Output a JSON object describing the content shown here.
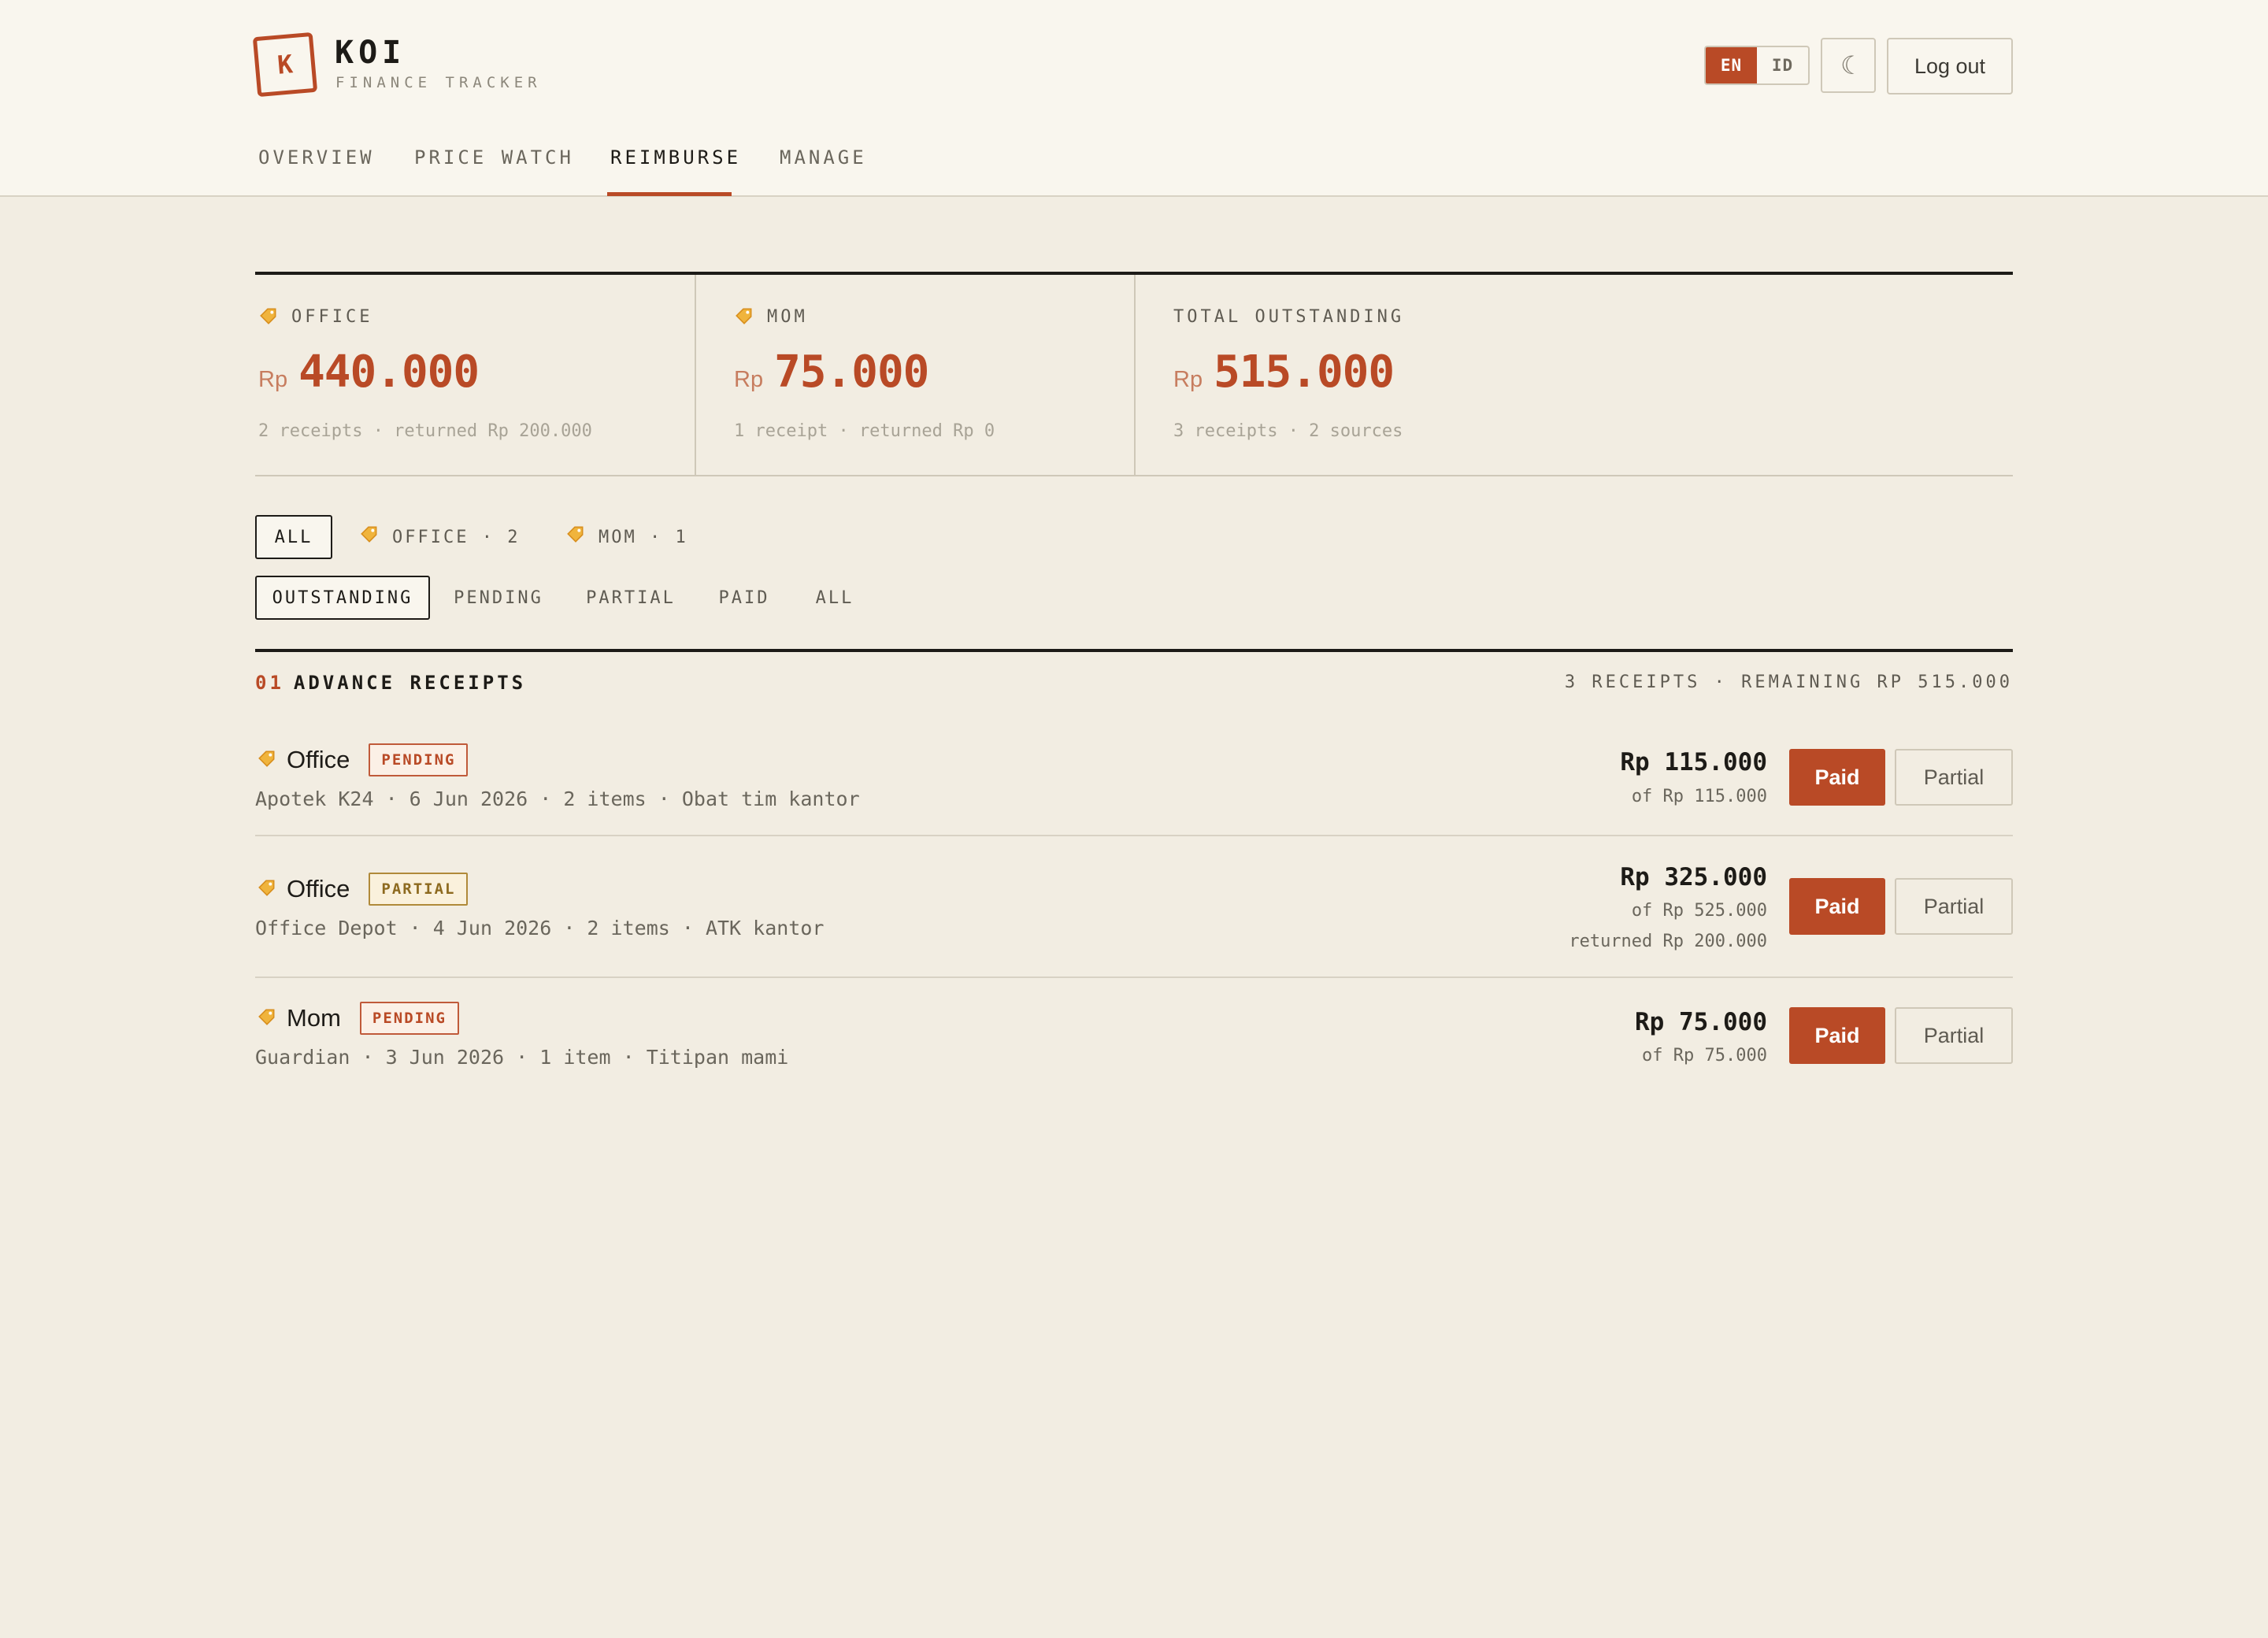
{
  "app": {
    "logo_letter": "K",
    "name": "KOI",
    "subtitle": "FINANCE TRACKER"
  },
  "header": {
    "lang_en": "EN",
    "lang_id": "ID",
    "theme_icon": "☾",
    "logout_label": "Log out"
  },
  "nav": {
    "tabs": [
      "OVERVIEW",
      "PRICE WATCH",
      "REIMBURSE",
      "MANAGE"
    ],
    "active": "REIMBURSE"
  },
  "summary": [
    {
      "label": "OFFICE",
      "currency": "Rp",
      "amount": "440.000",
      "sub": "2 receipts · returned Rp 200.000",
      "icon": "tag-icon"
    },
    {
      "label": "MOM",
      "currency": "Rp",
      "amount": "75.000",
      "sub": "1 receipt · returned Rp 0",
      "icon": "tag-icon"
    },
    {
      "label": "TOTAL OUTSTANDING",
      "currency": "Rp",
      "amount": "515.000",
      "sub": "3 receipts · 2 sources"
    }
  ],
  "source_filters": [
    "ALL",
    "OFFICE · 2",
    "MOM · 1"
  ],
  "status_filters": [
    "OUTSTANDING",
    "PENDING",
    "PARTIAL",
    "PAID",
    "ALL"
  ],
  "section": {
    "number": "01",
    "title": "ADVANCE RECEIPTS",
    "meta": "3 RECEIPTS · REMAINING RP 515.000"
  },
  "receipts": [
    {
      "source": "Office",
      "status": "PENDING",
      "meta": "Apotek K24 · 6 Jun 2026 · 2 items · Obat tim kantor",
      "amount": "Rp 115.000",
      "of": "of Rp 115.000",
      "returned": ""
    },
    {
      "source": "Office",
      "status": "PARTIAL",
      "meta": "Office Depot · 4 Jun 2026 · 2 items · ATK kantor",
      "amount": "Rp 325.000",
      "of": "of Rp 525.000",
      "returned": "returned Rp 200.000"
    },
    {
      "source": "Mom",
      "status": "PENDING",
      "meta": "Guardian · 3 Jun 2026 · 1 item · Titipan mami",
      "amount": "Rp 75.000",
      "of": "of Rp 75.000",
      "returned": ""
    }
  ],
  "actions": {
    "paid": "Paid",
    "partial": "Partial"
  },
  "colors": {
    "accent": "#b94a26",
    "background": "#f2ede2",
    "header": "#f9f6ee",
    "partial_badge": "#8d6a1f"
  }
}
